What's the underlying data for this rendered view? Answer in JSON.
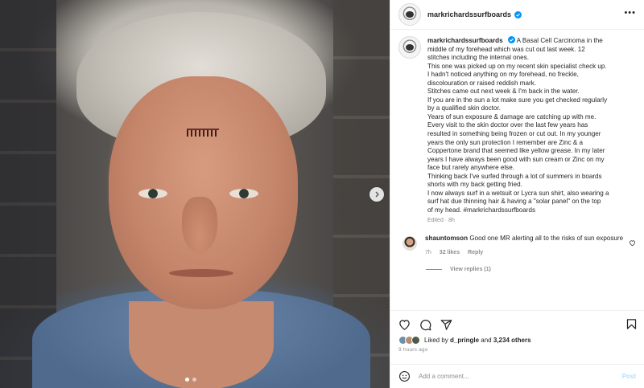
{
  "post": {
    "username": "markrichardssurfboards",
    "caption_lines": [
      "A Basal Cell Carcinoma in the",
      "middle of my forehead which was cut out last week. 12",
      "stitches including the internal ones.",
      "This one was picked up on my recent skin specialist check up.",
      "I hadn't noticed anything on my forehead, no freckle,",
      "discolouration or raised reddish mark.",
      "Stitches came out next week & I'm back in the water.",
      "If you are in the sun a lot make sure you get checked regularly",
      "by a qualified skin doctor.",
      "Years of sun exposure & damage are catching up with me.",
      "Every visit to the skin doctor over the last few years has",
      "resulted in something being frozen or cut out. In my younger",
      "years the only sun protection I remember are Zinc & a",
      "Coppertone brand that seemed like yellow grease. In my later",
      "years I have always been good with sun cream or Zinc on my",
      "face but rarely anywhere else.",
      "Thinking back I've surfed through a lot of summers in boards",
      "shorts with my back getting fried.",
      "I now always surf in a wetsuit or Lycra sun shirt, also wearing a",
      "surf hat due thinning hair & having a \"solar panel\" on the top",
      "of my head. #markrichardssurfboards"
    ],
    "edited": "Edited · 8h",
    "liked_by_prefix": "Liked by",
    "liked_by_user": "d_pringle",
    "liked_by_and": "and",
    "likes_count": "3,234 others",
    "time_ago": "9 hours ago",
    "carousel_slides": 2,
    "carousel_active": 1
  },
  "comment": {
    "username": "shauntomson",
    "text": "Good one MR alerting all to the risks of sun exposure",
    "time": "7h",
    "likes": "32 likes",
    "reply": "Reply",
    "view_replies": "View replies (1)"
  },
  "compose": {
    "placeholder": "Add a comment...",
    "post_label": "Post"
  },
  "colors": {
    "verified": "#0095f6",
    "text": "#262626",
    "muted": "#8e8e8e",
    "post_disabled": "#b2dffc"
  },
  "icons": [
    "more-icon",
    "verified-icon",
    "next-arrow-icon",
    "heart-icon",
    "comment-icon",
    "share-icon",
    "bookmark-icon",
    "emoji-icon"
  ]
}
